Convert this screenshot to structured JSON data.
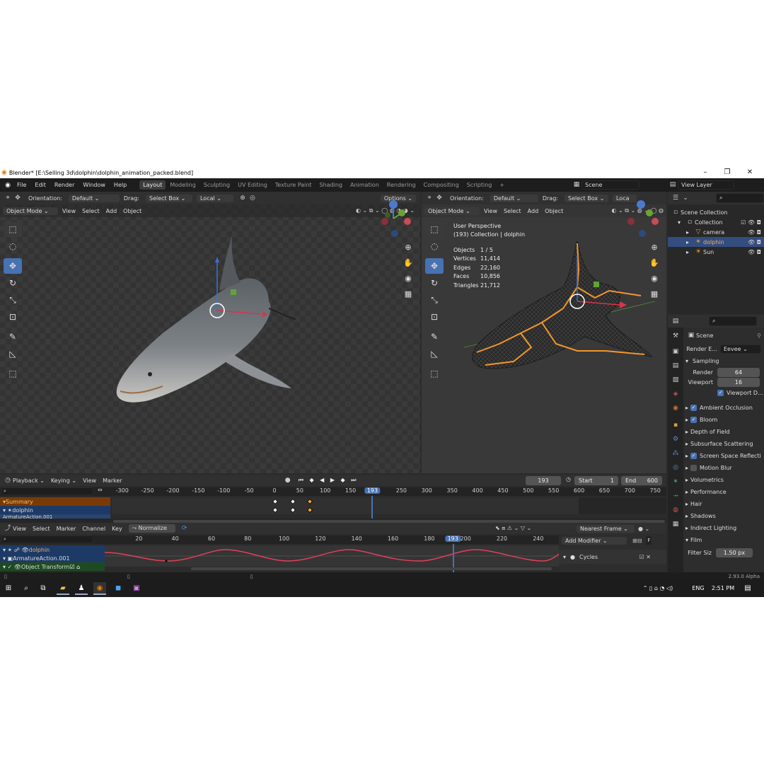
{
  "window": {
    "title": "Blender* [E:\\Selling 3d\\dolphin\\dolphin_animation_packed.blend]"
  },
  "menus": [
    "File",
    "Edit",
    "Render",
    "Window",
    "Help"
  ],
  "workspaces": [
    "Layout",
    "Modeling",
    "Sculpting",
    "UV Editing",
    "Texture Paint",
    "Shading",
    "Animation",
    "Rendering",
    "Compositing",
    "Scripting"
  ],
  "scene": {
    "label": "Scene",
    "view_layer": "View Layer"
  },
  "left_view": {
    "orientation_label": "Orientation:",
    "orientation_value": "Default",
    "drag_label": "Drag:",
    "drag_value": "Select Box",
    "pivot": "Local",
    "options": "Options",
    "mode": "Object Mode",
    "menu": [
      "View",
      "Select",
      "Add",
      "Object"
    ]
  },
  "right_view": {
    "orientation_label": "Orientation:",
    "orientation_value": "Default",
    "drag_label": "Drag:",
    "drag_value": "Select Box",
    "pivot": "Loca",
    "mode": "Object Mode",
    "menu": [
      "View",
      "Select",
      "Add",
      "Object"
    ],
    "overlay_title": "User Perspective",
    "overlay_sub": "(193) Collection | dolphin",
    "stats": [
      {
        "k": "Objects",
        "v": "1 / 5"
      },
      {
        "k": "Vertices",
        "v": "11,414"
      },
      {
        "k": "Edges",
        "v": "22,160"
      },
      {
        "k": "Faces",
        "v": "10,856"
      },
      {
        "k": "Triangles",
        "v": "21,712"
      }
    ]
  },
  "outliner": {
    "root": "Scene Collection",
    "items": [
      {
        "name": "Collection",
        "level": 1
      },
      {
        "name": "camera",
        "level": 2
      },
      {
        "name": "dolphin",
        "level": 2
      },
      {
        "name": "Sun",
        "level": 2
      }
    ]
  },
  "properties": {
    "scene": "Scene",
    "render_engine_label": "Render E...",
    "render_engine": "Eevee",
    "sampling": "Sampling",
    "render_label": "Render",
    "render_value": "64",
    "viewport_label": "Viewport",
    "viewport_value": "16",
    "viewport_denoise": "Viewport D...",
    "panels": [
      {
        "name": "Ambient Occlusion",
        "check": true
      },
      {
        "name": "Bloom",
        "check": true
      },
      {
        "name": "Depth of Field",
        "check": null
      },
      {
        "name": "Subsurface Scattering",
        "check": null
      },
      {
        "name": "Screen Space Reflecti",
        "check": true
      },
      {
        "name": "Motion Blur",
        "check": false
      },
      {
        "name": "Volumetrics",
        "check": null
      },
      {
        "name": "Performance",
        "check": null
      },
      {
        "name": "Hair",
        "check": null
      },
      {
        "name": "Shadows",
        "check": null
      },
      {
        "name": "Indirect Lighting",
        "check": null
      },
      {
        "name": "Film",
        "check": null
      }
    ],
    "filter_label": "Filter Siz",
    "filter_value": "1.50 px"
  },
  "timeline": {
    "menus": [
      "Playback",
      "Keying",
      "View",
      "Marker"
    ],
    "current": "193",
    "start_label": "Start",
    "start": "1",
    "end_label": "End",
    "end": "600",
    "ticks": [
      "-300",
      "-250",
      "-200",
      "-150",
      "-100",
      "-50",
      "0",
      "50",
      "100",
      "150",
      "193",
      "250",
      "300",
      "350",
      "400",
      "450",
      "500",
      "550",
      "600",
      "650",
      "700",
      "750"
    ],
    "rows": [
      "Summary",
      "dolphin",
      "ArmatureAction.001"
    ]
  },
  "graph": {
    "menus": [
      "View",
      "Select",
      "Marker",
      "Channel",
      "Key"
    ],
    "normalize": "Normalize",
    "snap": "Nearest Frame",
    "ticks": [
      "20",
      "40",
      "60",
      "80",
      "100",
      "120",
      "140",
      "160",
      "180",
      "193",
      "200",
      "220",
      "240"
    ],
    "rows": [
      "dolphin",
      "ArmatureAction.001",
      "Object Transform"
    ]
  },
  "modifier": {
    "add": "Add Modifier",
    "cycles": "Cycles"
  },
  "status": {
    "version": "2.93.0 Alpha"
  },
  "taskbar": {
    "lang": "ENG",
    "time": "2:51 PM"
  }
}
